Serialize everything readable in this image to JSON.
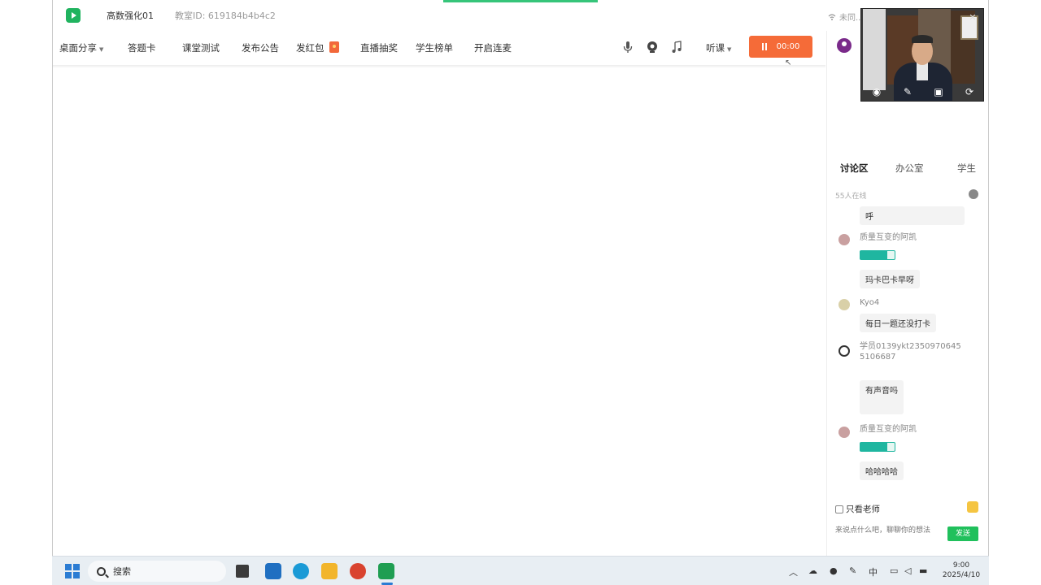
{
  "titlebar": {
    "class_name": "高数强化01",
    "class_id": "教室ID: 619184b4b4c2",
    "network": "未同..."
  },
  "toolbar": {
    "desktop_share": "桌面分享",
    "answer_card": "答题卡",
    "quiz": "课堂测试",
    "announce": "发布公告",
    "red_packet": "发红包",
    "lottery": "直播抽奖",
    "student_list": "学生榜单",
    "mic_link": "开启连麦",
    "listen_mode": "听课",
    "record_time": "00:00"
  },
  "panel": {
    "tabs": [
      "讨论区",
      "办公室",
      "学生"
    ],
    "online": "55人在线",
    "messages": [
      {
        "name": "",
        "text": "呼"
      },
      {
        "name": "质量互变的阿凯",
        "text": "玛卡巴卡早呀"
      },
      {
        "name": "Kyo4",
        "text": "每日一题还没打卡"
      },
      {
        "name": "学员0139ykt23509706455106687",
        "text": "有声音吗"
      },
      {
        "name": "质量互变的阿凯",
        "text": "哈哈哈哈"
      }
    ],
    "teacher_only": "只看老师",
    "input_placeholder": "来说点什么吧，聊聊你的想法",
    "send": "发送"
  },
  "taskbar": {
    "search": "搜索",
    "ime": "中",
    "time": "9:00",
    "date": "2025/4/10"
  },
  "colors": {
    "accent_green": "#20b35f",
    "record_orange": "#f56b38",
    "badge_teal": "#1fb6a0",
    "windows_blue": "#2b7cd3"
  }
}
